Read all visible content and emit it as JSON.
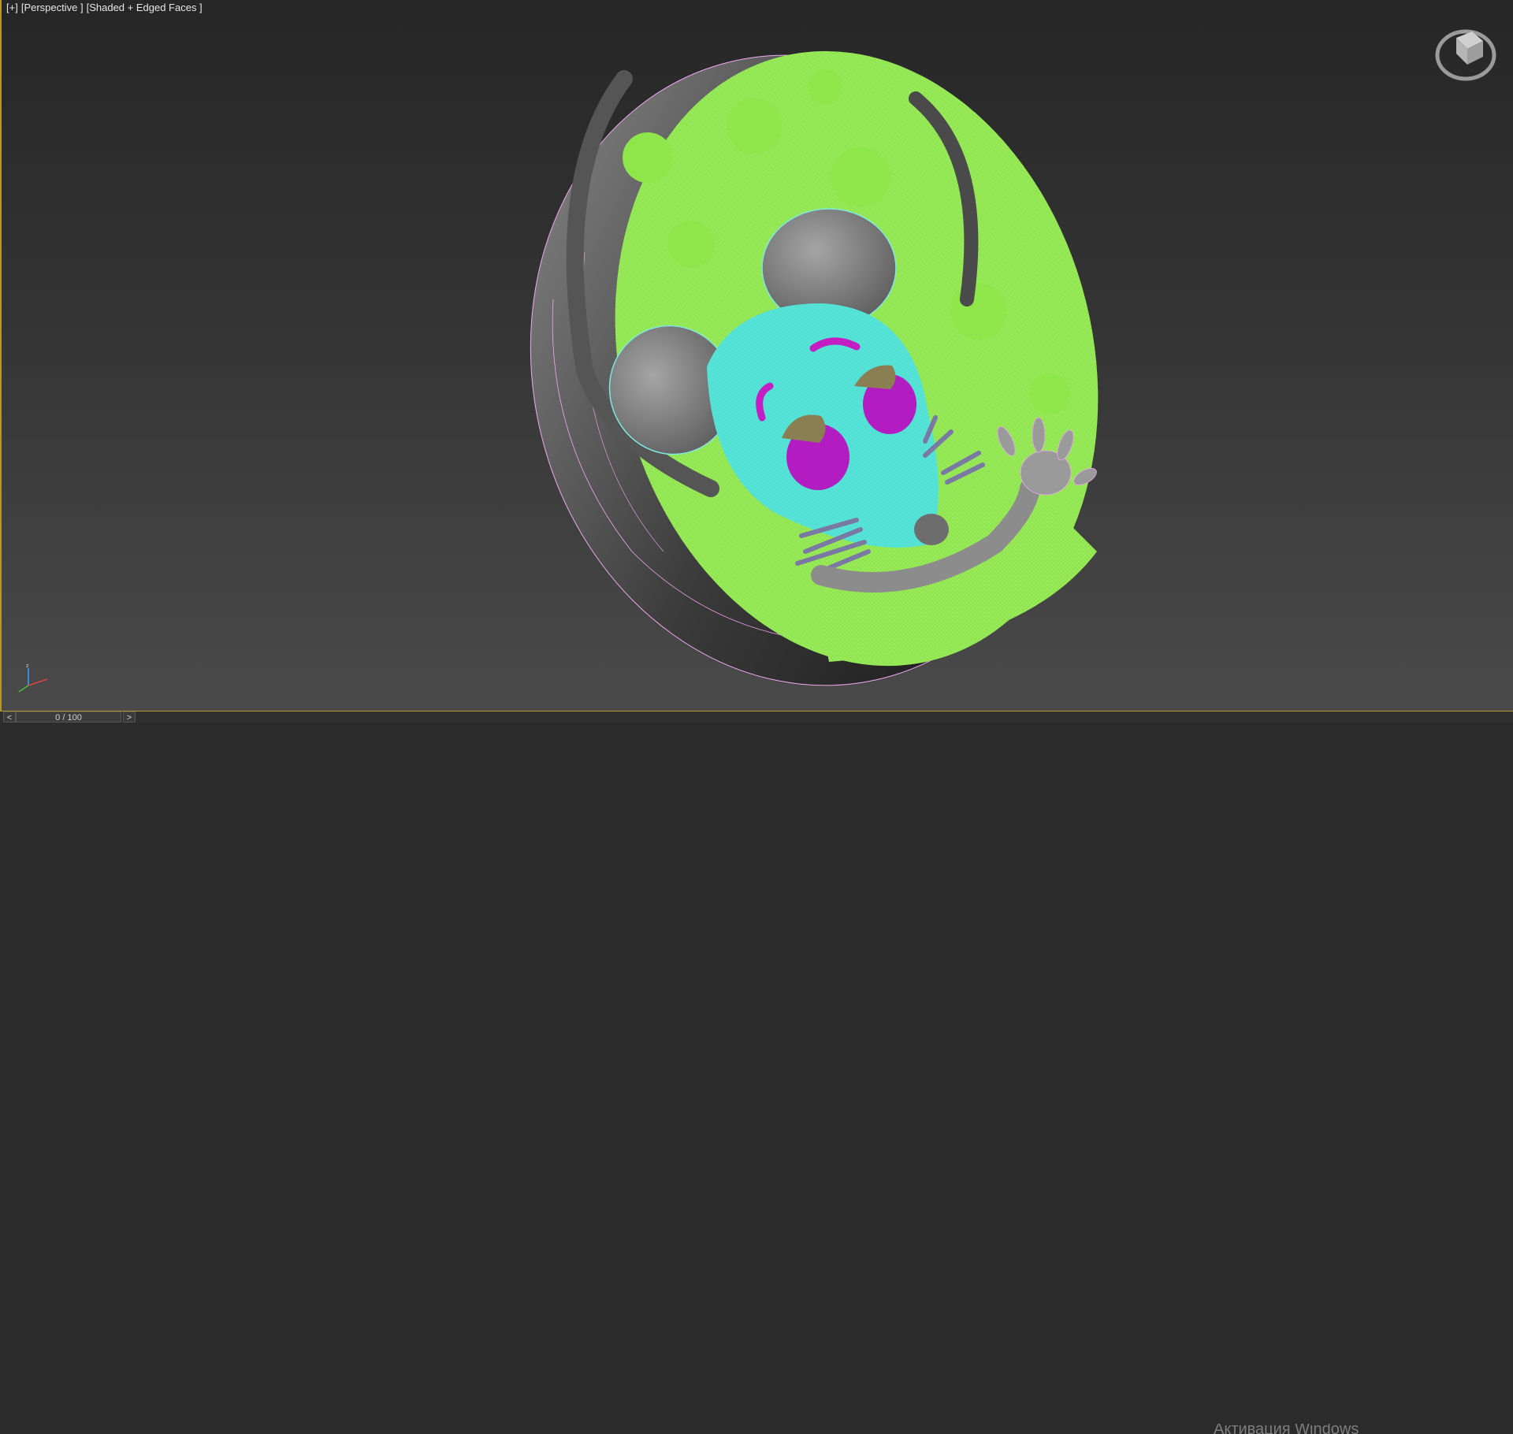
{
  "viewport": {
    "label_plus": "[+]",
    "label_view": "[Perspective ]",
    "label_shading": "[Shaded + Edged Faces ]"
  },
  "viewcube": {
    "icon": "viewcube-icon"
  },
  "axis": {
    "x": "x",
    "y": "y",
    "z": "z"
  },
  "timeline": {
    "prev": "<",
    "next": ">",
    "frame_readout": "0 / 100"
  },
  "watermark": {
    "text": "Активация Windows"
  },
  "colors": {
    "cheese": "#8fe64b",
    "mouse_head": "#4fe0d4",
    "eyes": "#b31cc0",
    "rim": "#3c3c3c",
    "edges": "#f0a8f0",
    "viewport_border": "#b8962e"
  }
}
